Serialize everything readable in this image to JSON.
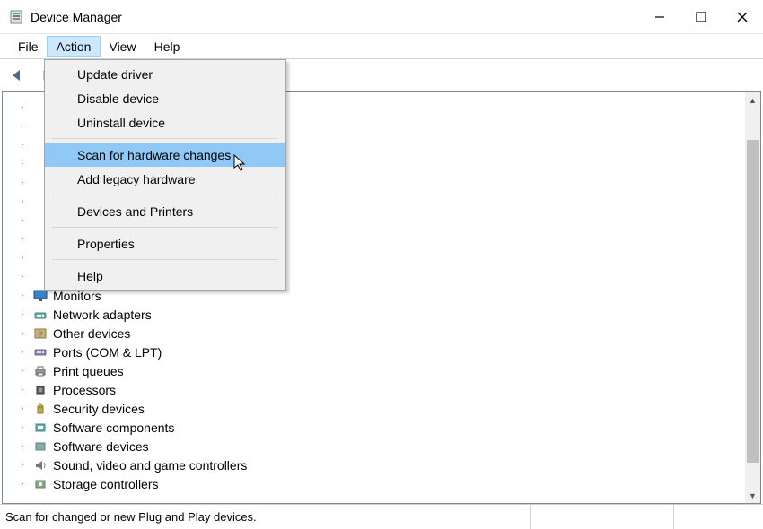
{
  "window": {
    "title": "Device Manager"
  },
  "menubar": {
    "file": "File",
    "action": "Action",
    "view": "View",
    "help": "Help"
  },
  "action_menu": {
    "update_driver": "Update driver",
    "disable_device": "Disable device",
    "uninstall_device": "Uninstall device",
    "scan_hardware": "Scan for hardware changes",
    "add_legacy": "Add legacy hardware",
    "devices_printers": "Devices and Printers",
    "properties": "Properties",
    "help": "Help"
  },
  "tree": {
    "items": [
      {
        "label": "Monitors"
      },
      {
        "label": "Network adapters"
      },
      {
        "label": "Other devices"
      },
      {
        "label": "Ports (COM & LPT)"
      },
      {
        "label": "Print queues"
      },
      {
        "label": "Processors"
      },
      {
        "label": "Security devices"
      },
      {
        "label": "Software components"
      },
      {
        "label": "Software devices"
      },
      {
        "label": "Sound, video and game controllers"
      },
      {
        "label": "Storage controllers"
      }
    ]
  },
  "statusbar": {
    "text": "Scan for changed or new Plug and Play devices."
  }
}
